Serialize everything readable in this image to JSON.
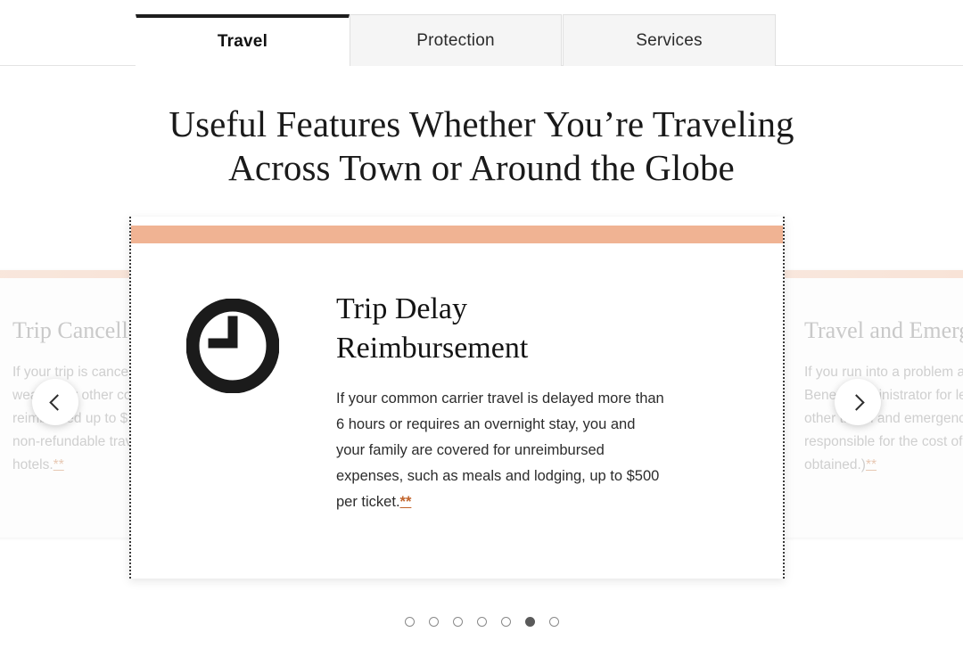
{
  "tabs": [
    {
      "label": "Travel",
      "active": true
    },
    {
      "label": "Protection",
      "active": false
    },
    {
      "label": "Services",
      "active": false
    }
  ],
  "heading": {
    "line1": "Useful Features Whether You’re Traveling",
    "line2": "Across Town or Around the Globe"
  },
  "carousel": {
    "prev_label": "‹",
    "next_label": "›",
    "prev_name": "previous-slide",
    "next_name": "next-slide",
    "active_index": 5,
    "dot_count": 7,
    "main_card": {
      "icon": "clock-icon",
      "title": "Trip Delay Reimbursement",
      "body": "If your common carrier travel is delayed more than 6 hours or requires an overnight stay, you and your family are covered for unreimbursed expenses, such as meals and lodging, up to $500 per ticket.",
      "footnote_marker": "**",
      "accent_color": "#f0b393"
    },
    "prev_card": {
      "title": "Trip Cancellation/ Interruption Insurance",
      "body": "If your trip is canceled or interrupted due to severe weather or other covered situations, you can be reimbursed up to $10,000 per person for your pre-paid, non-refundable travel expenses, including flights and hotels.",
      "footnote_marker": "**"
    },
    "next_card": {
      "title": "Travel and Emergency Assistance Services",
      "body": "If you run into a problem away from home, call the Benefit Administrator for legal or medical referrals or other travel and emergency assistance. (You're responsible for the cost of any goods or services obtained.)",
      "footnote_marker": "**"
    }
  }
}
